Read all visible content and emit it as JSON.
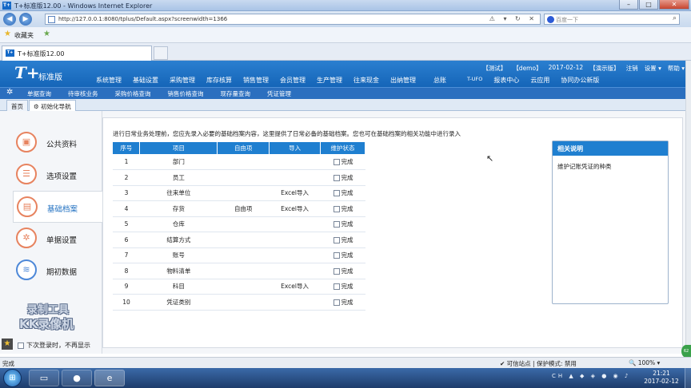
{
  "window": {
    "title": "T+标准版12.00 - Windows Internet Explorer",
    "min": "–",
    "max": "□",
    "close": "✕"
  },
  "browser": {
    "back": "◀",
    "forward": "▶",
    "url": "http://127.0.0.1:8080/tplus/Default.aspx?screenwidth=1366",
    "search_placeholder": "百度一下",
    "favorites_label": "收藏夹",
    "tab_title": "T+标准版12.00",
    "tab_icon": "T+"
  },
  "app": {
    "logo": "T+",
    "logo_sub": "标准版",
    "user_info": [
      "【测试】",
      "【demo】",
      "2017-02-12",
      "【演示版】",
      "注销",
      "设置 ▾",
      "帮助 ▾"
    ],
    "modules": [
      "系统管理",
      "基础设置",
      "采购管理",
      "库存核算",
      "销售管理",
      "会员管理",
      "生产管理",
      "往来现金",
      "出纳管理",
      "总账",
      "T-UFO",
      "报表中心",
      "云应用",
      "协同办公"
    ],
    "module_badge": "新版",
    "subnav": [
      "单据查询",
      "待审核业务",
      "采购价格查询",
      "销售价格查询",
      "现存量查询",
      "凭证管理"
    ],
    "page_tabs": [
      "首页",
      "初始化导航"
    ]
  },
  "leftnav": {
    "items": [
      {
        "label": "公共资料",
        "icon": "briefcase-icon",
        "glyph": "▣"
      },
      {
        "label": "选项设置",
        "icon": "list-settings-icon",
        "glyph": "☰"
      },
      {
        "label": "基础档案",
        "icon": "document-icon",
        "glyph": "▤"
      },
      {
        "label": "单据设置",
        "icon": "gear-icon",
        "glyph": "✲"
      },
      {
        "label": "期初数据",
        "icon": "database-icon",
        "glyph": "≋"
      }
    ],
    "watermark_line1": "录制工具",
    "watermark_line2": "KK录像机",
    "no_show_next": "下次登录时，不再显示"
  },
  "main": {
    "intro": "进行日常业务处理前，您应先录入必要的基础档案内容，这里提供了日常必备的基础档案。您也可在基础档案的相关功能中进行录入",
    "columns": [
      "序号",
      "项目",
      "自由项",
      "导入",
      "维护状态"
    ],
    "rows": [
      {
        "no": "1",
        "item": "部门",
        "free": "",
        "import": "",
        "status": "完成"
      },
      {
        "no": "2",
        "item": "员工",
        "free": "",
        "import": "",
        "status": "完成"
      },
      {
        "no": "3",
        "item": "往来单位",
        "free": "",
        "import": "Excel导入",
        "status": "完成"
      },
      {
        "no": "4",
        "item": "存货",
        "free": "自由项",
        "import": "Excel导入",
        "status": "完成"
      },
      {
        "no": "5",
        "item": "仓库",
        "free": "",
        "import": "",
        "status": "完成"
      },
      {
        "no": "6",
        "item": "结算方式",
        "free": "",
        "import": "",
        "status": "完成"
      },
      {
        "no": "7",
        "item": "账号",
        "free": "",
        "import": "",
        "status": "完成"
      },
      {
        "no": "8",
        "item": "物料清单",
        "free": "",
        "import": "",
        "status": "完成"
      },
      {
        "no": "9",
        "item": "科目",
        "free": "",
        "import": "Excel导入",
        "status": "完成"
      },
      {
        "no": "10",
        "item": "凭证类别",
        "free": "",
        "import": "",
        "status": "完成"
      }
    ],
    "help_title": "相关说明",
    "help_body": "维护记账凭证的种类"
  },
  "statusbar": {
    "left": "完成",
    "zone": "✔ 可信站点 | 保护模式: 禁用",
    "zoom": "🔍 100% ▾"
  },
  "taskbar": {
    "start": "⊞",
    "time": "21:21",
    "date": "2017-02-12"
  },
  "colors": {
    "brand_blue": "#1f7fd0",
    "accent_orange": "#e7835f"
  }
}
